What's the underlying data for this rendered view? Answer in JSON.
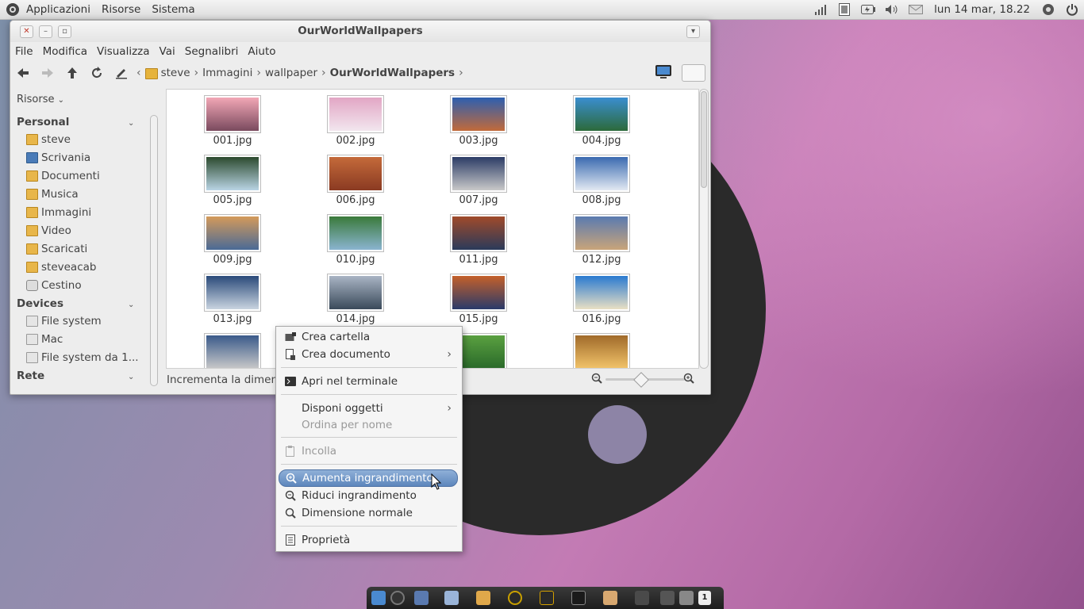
{
  "top_panel": {
    "menus": [
      "Applicazioni",
      "Risorse",
      "Sistema"
    ],
    "clock": "lun 14 mar, 18.22"
  },
  "window": {
    "title": "OurWorldWallpapers",
    "menubar": [
      "File",
      "Modifica",
      "Visualizza",
      "Vai",
      "Segnalibri",
      "Aiuto"
    ],
    "breadcrumbs": [
      "steve",
      "Immagini",
      "wallpaper",
      "OurWorldWallpapers"
    ],
    "sidebar": {
      "header": "Risorse",
      "sections": {
        "personal": "Personal",
        "devices": "Devices",
        "network": "Rete"
      },
      "personal_items": [
        "steve",
        "Scrivania",
        "Documenti",
        "Musica",
        "Immagini",
        "Video",
        "Scaricati",
        "steveacab",
        "Cestino"
      ],
      "device_items": [
        "File system",
        "Mac",
        "File system da 1..."
      ]
    },
    "files": [
      {
        "name": "001.jpg",
        "colors": [
          "#f2a7b6",
          "#7a4a5e"
        ]
      },
      {
        "name": "002.jpg",
        "colors": [
          "#e2a6c4",
          "#f2e6ee"
        ]
      },
      {
        "name": "003.jpg",
        "colors": [
          "#2d5fb0",
          "#c26a3a"
        ]
      },
      {
        "name": "004.jpg",
        "colors": [
          "#3a8ed0",
          "#2c6a3a"
        ]
      },
      {
        "name": "005.jpg",
        "colors": [
          "#2c4a2e",
          "#b9d4e4"
        ]
      },
      {
        "name": "006.jpg",
        "colors": [
          "#c46a3a",
          "#8a3a22"
        ]
      },
      {
        "name": "007.jpg",
        "colors": [
          "#2b3c66",
          "#c9c9c9"
        ]
      },
      {
        "name": "008.jpg",
        "colors": [
          "#3a6ab0",
          "#e2e9f2"
        ]
      },
      {
        "name": "009.jpg",
        "colors": [
          "#d49a5a",
          "#4a6a96"
        ]
      },
      {
        "name": "010.jpg",
        "colors": [
          "#3a7a3a",
          "#8ab4d0"
        ]
      },
      {
        "name": "011.jpg",
        "colors": [
          "#a04a2a",
          "#2a3a5a"
        ]
      },
      {
        "name": "012.jpg",
        "colors": [
          "#5a7ab0",
          "#c9a47a"
        ]
      },
      {
        "name": "013.jpg",
        "colors": [
          "#2a4a7a",
          "#c9d4e0"
        ]
      },
      {
        "name": "014.jpg",
        "colors": [
          "#a9b4c4",
          "#3a4a5a"
        ]
      },
      {
        "name": "015.jpg",
        "colors": [
          "#c4602a",
          "#2a3a6a"
        ]
      },
      {
        "name": "016.jpg",
        "colors": [
          "#2a7ad0",
          "#e9e0c4"
        ]
      },
      {
        "name": "",
        "colors": [
          "#3a5a8a",
          "#c9c9c9"
        ]
      },
      {
        "name": "",
        "colors": [
          "#5aa040",
          "#2a6a2a"
        ]
      },
      {
        "name": "",
        "colors": [
          "#a06a2a",
          "#f2c46a"
        ]
      }
    ],
    "status": "Incrementa la dimensione"
  },
  "context_menu": {
    "items": [
      {
        "label": "Crea cartella",
        "icon": "new-folder-icon"
      },
      {
        "label": "Crea documento",
        "icon": "new-document-icon",
        "submenu": true
      },
      {
        "label": "Apri nel terminale",
        "icon": "terminal-icon"
      },
      {
        "label": "Disponi oggetti",
        "submenu": true
      },
      {
        "label": "Ordina per nome",
        "disabled": true
      },
      {
        "label": "Incolla",
        "icon": "paste-icon",
        "disabled": true
      },
      {
        "label": "Aumenta ingrandimento",
        "icon": "zoom-in-icon",
        "highlighted": true
      },
      {
        "label": "Riduci ingrandimento",
        "icon": "zoom-out-icon"
      },
      {
        "label": "Dimensione normale",
        "icon": "zoom-normal-icon"
      },
      {
        "label": "Proprietà",
        "icon": "properties-icon"
      }
    ]
  },
  "dock": {
    "workspace": "1"
  },
  "colors": {
    "highlight": "#6a90c4",
    "folder": "#e8b64a"
  }
}
